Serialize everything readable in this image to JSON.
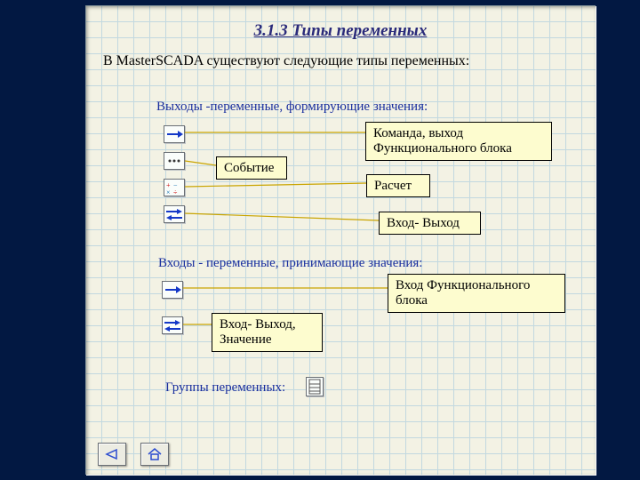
{
  "title": "3.1.3 Типы переменных",
  "intro": "В MasterSCADA существуют следующие типы переменных:",
  "section_outputs": "Выходы  -переменные, формирующие значения:",
  "section_inputs": "Входы - переменные, принимающие значения:",
  "section_groups": "Группы переменных:",
  "callouts": {
    "event": "Событие",
    "command_fb_out": "Команда, выход Функционального блока",
    "calc": "Расчет",
    "inout": "Вход- Выход",
    "fb_in": "Вход Функционального блока",
    "inout_value": "Вход- Выход, Значение"
  },
  "nav": {
    "back": "back",
    "home": "home"
  }
}
